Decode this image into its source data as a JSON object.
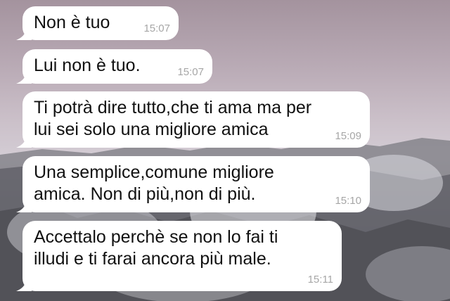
{
  "chat": {
    "messages": [
      {
        "text": "Non è tuo",
        "time": "15:07"
      },
      {
        "text": "Lui non è tuo.",
        "time": "15:07"
      },
      {
        "text": "Ti potrà dire tutto,che ti ama ma per\nlui sei solo una migliore amica",
        "time": "15:09"
      },
      {
        "text": "Una semplice,comune migliore\namica. Non di più,non di più.",
        "time": "15:10"
      },
      {
        "text": "Accettalo perchè se non lo fai ti\nilludi e ti farai ancora più male.",
        "time": "15:11"
      }
    ]
  },
  "colors": {
    "bubble_background": "#ffffff",
    "message_text": "#111111",
    "timestamp_text": "#a6a6a6"
  }
}
